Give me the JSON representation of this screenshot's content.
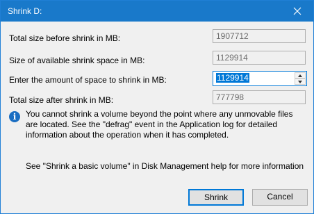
{
  "dialog": {
    "title": "Shrink D:"
  },
  "fields": {
    "total_before_label": "Total size before shrink in MB:",
    "total_before_value": "1907712",
    "available_label": "Size of available shrink space in MB:",
    "available_value": "1129914",
    "amount_label": "Enter the amount of space to shrink in MB:",
    "amount_value": "1129914",
    "total_after_label": "Total size after shrink in MB:",
    "total_after_value": "777798"
  },
  "info": {
    "icon": "info-icon",
    "message": "You cannot shrink a volume beyond the point where any unmovable files are located. See the \"defrag\" event in the Application log for detailed information about the operation when it has completed.",
    "help_text": "See \"Shrink a basic volume\" in Disk Management help for more information"
  },
  "buttons": {
    "shrink": "Shrink",
    "cancel": "Cancel"
  },
  "colors": {
    "titlebar": "#1979ca",
    "accent": "#0078d7"
  }
}
